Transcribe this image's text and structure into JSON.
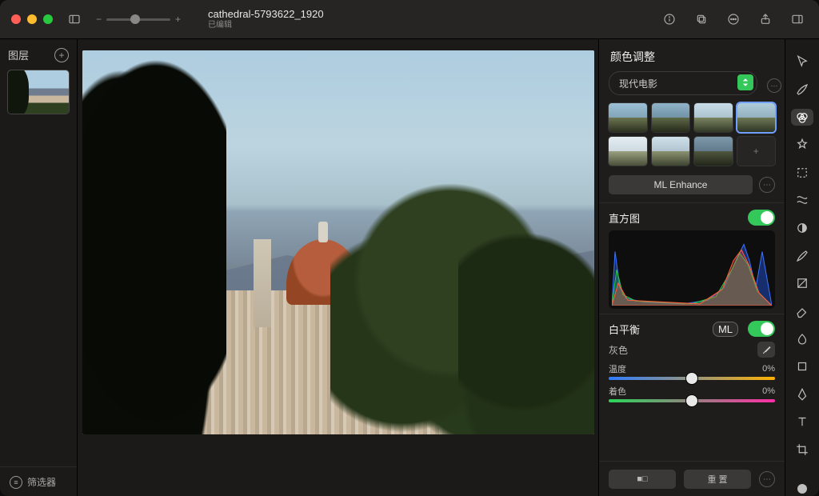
{
  "titlebar": {
    "filename": "cathedral-5793622_1920",
    "edited": "已编辑",
    "zoom_minus": "−",
    "zoom_plus": "+"
  },
  "left_panel": {
    "title": "图层",
    "footer": "筛选器"
  },
  "inspector": {
    "panel_title": "颜色调整",
    "preset_row_label": "现代电影",
    "ml_button": "ML Enhance",
    "histogram_label": "直方图",
    "white_balance_label": "白平衡",
    "ml_badge": "ML",
    "gray_label": "灰色",
    "temp_label": "温度",
    "temp_value": "0%",
    "tint_label": "着色",
    "tint_value": "0%",
    "reset_button": "重 置",
    "compare_button": "■□"
  },
  "colors": {
    "accent_green": "#34c759",
    "temp_gradient": [
      "#2e7cff",
      "#ffb000"
    ],
    "tint_gradient": [
      "#29d65a",
      "#ff2ea6"
    ]
  }
}
